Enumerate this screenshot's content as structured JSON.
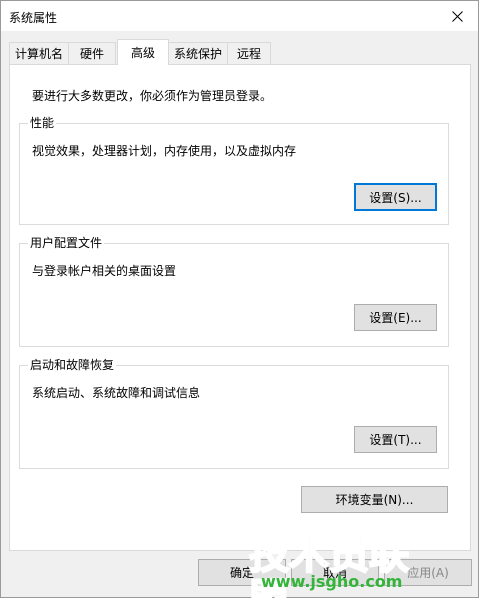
{
  "window": {
    "title": "系统属性"
  },
  "tabs": [
    {
      "label": "计算机名"
    },
    {
      "label": "硬件"
    },
    {
      "label": "高级",
      "active": true
    },
    {
      "label": "系统保护"
    },
    {
      "label": "远程"
    }
  ],
  "panel": {
    "notice": "要进行大多数更改，你必须作为管理员登录。",
    "performance": {
      "label": "性能",
      "desc": "视觉效果，处理器计划，内存使用，以及虚拟内存",
      "button": "设置(S)..."
    },
    "profiles": {
      "label": "用户配置文件",
      "desc": "与登录帐户相关的桌面设置",
      "button": "设置(E)..."
    },
    "startup": {
      "label": "启动和故障恢复",
      "desc": "系统启动、系统故障和调试信息",
      "button": "设置(T)..."
    },
    "env_button": "环境变量(N)..."
  },
  "footer": {
    "ok": "确定",
    "cancel": "取消",
    "apply": "应用(A)"
  },
  "watermark": {
    "title": "技术员联盟",
    "url": "www.jsgho.com"
  },
  "colors": {
    "accent": "#0078d7",
    "watermark": "#34b43a"
  }
}
